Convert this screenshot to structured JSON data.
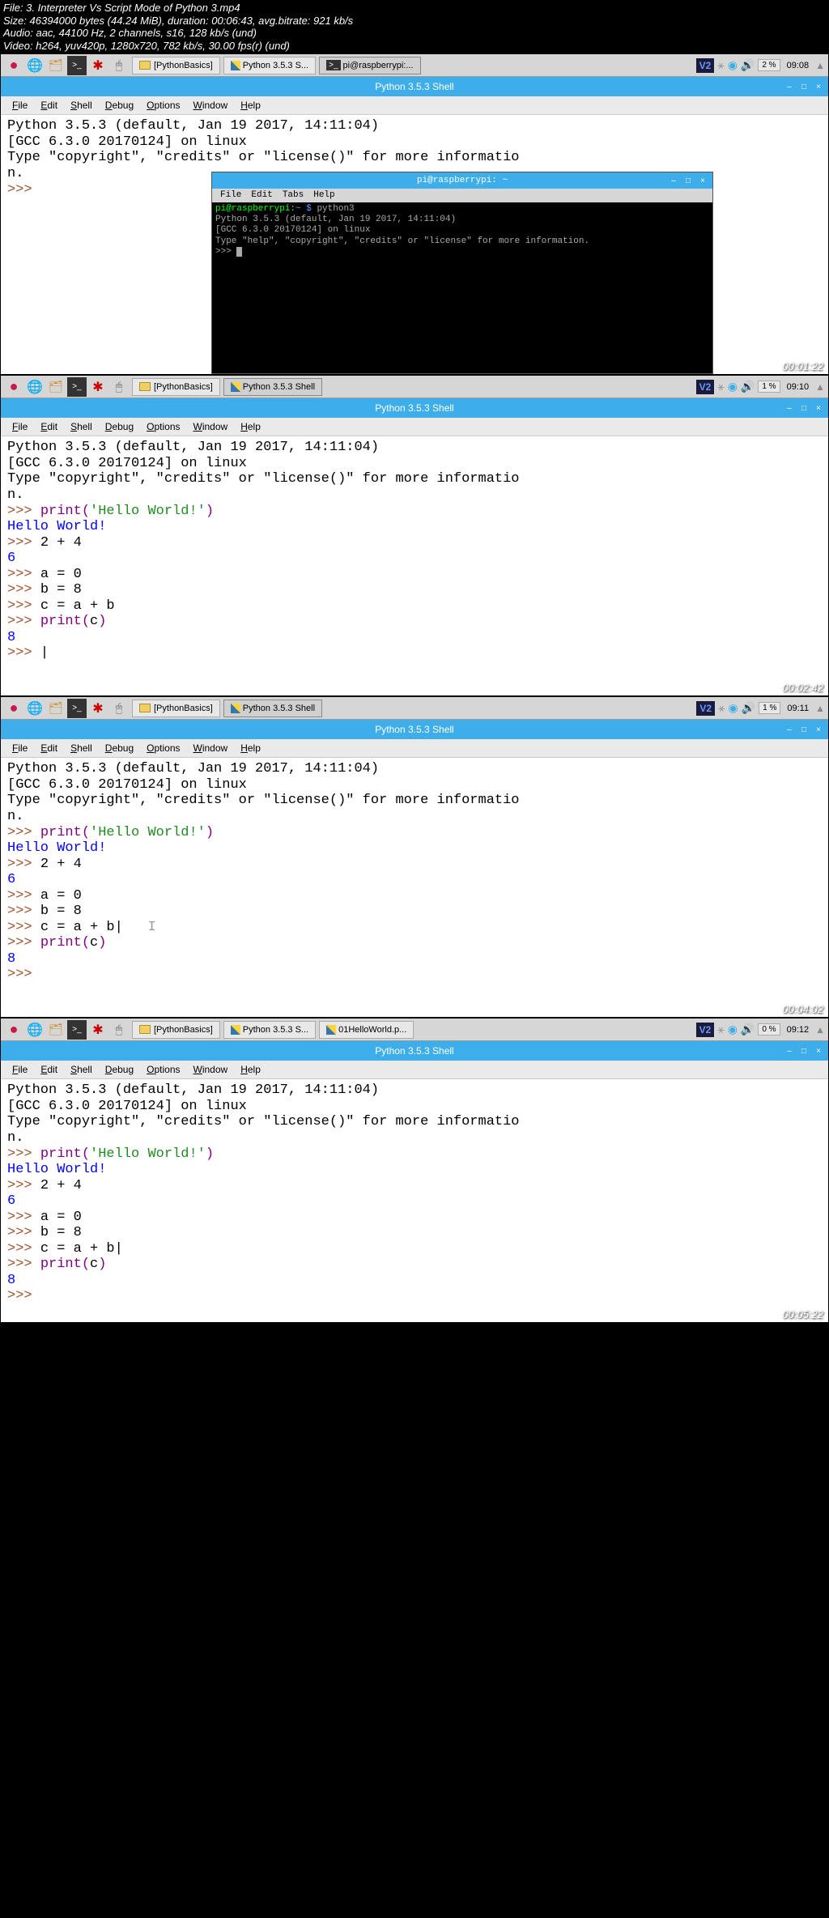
{
  "metadata": {
    "file": "File: 3. Interpreter Vs Script Mode of Python 3.mp4",
    "size": "Size: 46394000 bytes (44.24 MiB), duration: 00:06:43, avg.bitrate: 921 kb/s",
    "audio": "Audio: aac, 44100 Hz, 2 channels, s16, 128 kb/s (und)",
    "video": "Video: h264, yuv420p, 1280x720, 782 kb/s, 30.00 fps(r) (und)"
  },
  "taskbar": {
    "btn_basics": "[PythonBasics]",
    "btn_shell": "Python 3.5.3 Shell",
    "btn_shell_short": "Python 3.5.3 S...",
    "btn_pi": "pi@raspberrypi:...",
    "btn_hello": "01HelloWorld.p...",
    "vnc": "V2"
  },
  "frames": [
    {
      "time": "09:08",
      "pct": "2 %",
      "timestamp": "00:01:22"
    },
    {
      "time": "09:10",
      "pct": "1 %",
      "timestamp": "00:02:42"
    },
    {
      "time": "09:11",
      "pct": "1 %",
      "timestamp": "00:04:02"
    },
    {
      "time": "09:12",
      "pct": "0 %",
      "timestamp": "00:05:22"
    }
  ],
  "window": {
    "title": "Python 3.5.3 Shell",
    "menus": [
      "File",
      "Edit",
      "Shell",
      "Debug",
      "Options",
      "Window",
      "Help"
    ]
  },
  "terminal": {
    "title": "pi@raspberrypi: ~",
    "menus": [
      "File",
      "Edit",
      "Tabs",
      "Help"
    ],
    "prompt_user": "pi@raspberrypi",
    "prompt_path": "~ $",
    "cmd": " python3",
    "line1": "Python 3.5.3 (default, Jan 19 2017, 14:11:04)",
    "line2": "[GCC 6.3.0 20170124] on linux",
    "line3": "Type \"help\", \"copyright\", \"credits\" or \"license\" for more information.",
    "line4": ">>> "
  },
  "shell": {
    "header1": "Python 3.5.3 (default, Jan 19 2017, 14:11:04)",
    "header2": "[GCC 6.3.0 20170124] on linux",
    "header3": "Type \"copyright\", \"credits\" or \"license()\" for more informatio",
    "header4": "n.",
    "prompt": ">>> ",
    "print_kw": "print",
    "hello_str": "'Hello World!'",
    "hello_out": "Hello World!",
    "expr_24": "2 + 4",
    "out_6": "6",
    "a0": "a = 0",
    "b8": "b = 8",
    "cab": "c = a + b",
    "cab_cursor": "c = a + b|",
    "printc": "c",
    "out_8": "8",
    "cursor": "|"
  }
}
